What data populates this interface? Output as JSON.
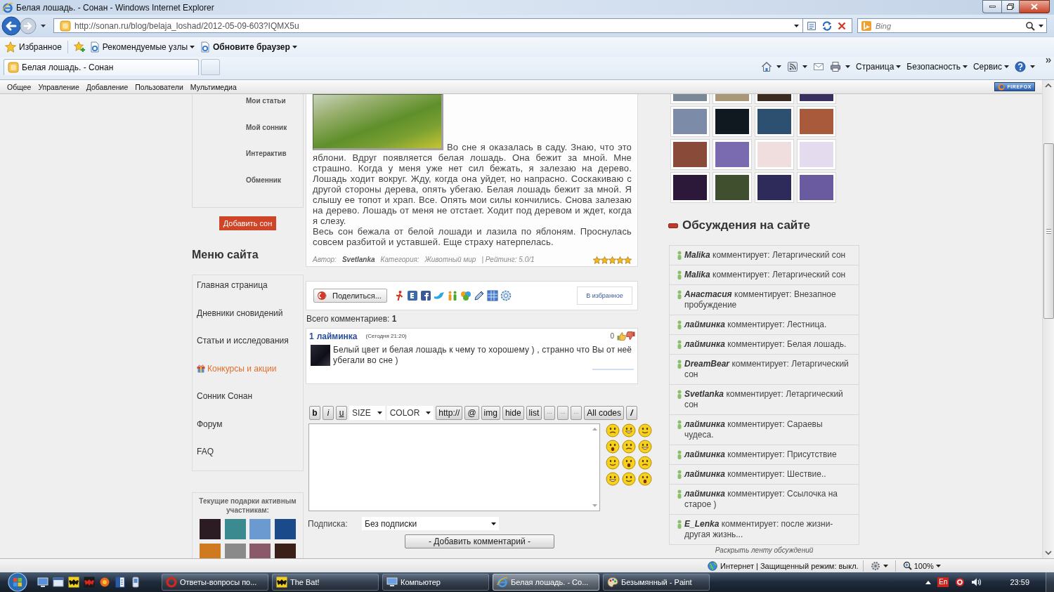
{
  "window": {
    "title": "Белая лошадь. - Сонан - Windows Internet Explorer"
  },
  "address_bar": {
    "url": "http://sonan.ru/blog/belaja_loshad/2012-05-09-603?IQMX5u",
    "search_placeholder": "Bing"
  },
  "favorites_bar": {
    "favorites": "Избранное",
    "links": [
      {
        "label": "Рекомендуемые узлы",
        "bold": false
      },
      {
        "label": "Обновите браузер",
        "bold": true
      }
    ]
  },
  "tabs": [
    {
      "label": "Белая лошадь. - Сонан",
      "selected": true
    }
  ],
  "command_bar": {
    "menus": [
      "Страница",
      "Безопасность",
      "Сервис"
    ]
  },
  "site_toolbar": {
    "items": [
      "Общее",
      "Управление",
      "Добавление",
      "Пользователи",
      "Мультимедиа"
    ],
    "badge": "FIREFOX"
  },
  "left_column": {
    "profile_links": [
      "Мои статьи",
      "Мой сонник",
      "Интерактив",
      "Обменник"
    ],
    "add_button": "Добавить сон",
    "menu_title": "Меню сайта",
    "menu_items": [
      {
        "label": "Главная страница",
        "kind": "link"
      },
      {
        "label": "Дневники сновидений",
        "kind": "link"
      },
      {
        "label": "Статьи и исследования",
        "kind": "link"
      },
      {
        "label": "Конкурсы и акции",
        "kind": "promo"
      },
      {
        "label": "Сонник Сонан",
        "kind": "link"
      },
      {
        "label": "Форум",
        "kind": "link"
      },
      {
        "label": "FAQ",
        "kind": "link"
      }
    ],
    "gifts_title": "Текущие подарки активным участникам:"
  },
  "article": {
    "paragraphs": [
      "Во сне я оказалась в саду. Знаю, что это яблони. Вдруг появляется белая лошадь. Она бежит за мной. Мне страшно. Когда у меня уже нет сил бежать, я залезаю на дерево. Лошадь ходит вокруг. Жду, когда она уйдет, но напрасно. Соскакиваю с другой стороны дерева, опять убегаю. Белая лошадь бежит за мной. Я слышу ее топот и храп. Все. Опять мои силы кончились. Снова залезаю на дерево. Лошадь от меня не отстает. Ходит под деревом и ждет, когда я слезу.",
      "Весь сон бежала от белой лошади и лазила по яблоням. Проснулась совсем разбитой и уставшей. Еще страху натерпелась."
    ],
    "author_label": "Автор:",
    "author": "Svetlanka",
    "category_label": "Категория:",
    "category": "Животный мир",
    "rating": "| Рейтинг: 5.0/1",
    "stars": 5
  },
  "share_bar": {
    "share_button": "Поделиться...",
    "favorite_button": "В избранное"
  },
  "comments": {
    "total": "Всего комментариев: **1**",
    "items": [
      {
        "number": "1",
        "author": "лайминка",
        "time": "(Сегодня 21:20)",
        "votes": "0",
        "text": "Белый цвет и белая лошадь к чему то хорошему ) , странно что Вы от неё убегали во сне )"
      }
    ]
  },
  "comment_form": {
    "toolbar": [
      {
        "label": "b",
        "kind": "bold"
      },
      {
        "label": "i",
        "kind": "italic"
      },
      {
        "label": "u",
        "kind": "underline"
      },
      {
        "label": "SIZE",
        "kind": "select"
      },
      {
        "label": "COLOR",
        "kind": "select"
      },
      {
        "label": "http://",
        "kind": "button"
      },
      {
        "label": "@",
        "kind": "button"
      },
      {
        "label": "img",
        "kind": "button"
      },
      {
        "label": "hide",
        "kind": "button"
      },
      {
        "label": "list",
        "kind": "button"
      },
      {
        "label": "···",
        "kind": "mini"
      },
      {
        "label": "···",
        "kind": "mini"
      },
      {
        "label": "···",
        "kind": "mini"
      },
      {
        "label": "All codes",
        "kind": "button"
      },
      {
        "label": "/",
        "kind": "bolditalic"
      }
    ],
    "subscription_label": "Подписка:",
    "subscription_value": "Без подписки",
    "submit": "- Добавить комментарий -"
  },
  "right_column": {
    "title": "Обсуждения на сайте",
    "discussions": [
      {
        "text": "**Malika** комментирует: Летаргический сон"
      },
      {
        "text": "**Malika** комментирует: Летаргический сон"
      },
      {
        "text": "**Анастасия** комментирует: Внезапное пробуждение"
      },
      {
        "text": "**лайминка** комментирует: Лестница."
      },
      {
        "text": "**лайминка** комментирует: Белая лошадь."
      },
      {
        "text": "**DreamBear** комментирует: Летаргический сон"
      },
      {
        "text": "**Svetlanka** комментирует: Летаргический сон"
      },
      {
        "text": "**лайминка** комментирует: Сараевы чудеса."
      },
      {
        "text": "**лайминка** комментирует: Присутствие"
      },
      {
        "text": "**лайминка** комментирует: Шествие.."
      },
      {
        "text": "**лайминка** комментирует: Ссылочка на старое )"
      },
      {
        "text": "**E_Lenka** комментирует: после жизни-другая жизнь..."
      }
    ],
    "more_link": "Раскрыть ленту обсуждений"
  },
  "status_bar": {
    "zone": "Интернет | Защищенный режим: выкл.",
    "zoom": "100%"
  },
  "taskbar": {
    "tasks": [
      {
        "label": "Ответы-вопросы по...",
        "kind": "ring",
        "selected": false
      },
      {
        "label": "The Bat!",
        "kind": "bat",
        "selected": false
      },
      {
        "label": "Компьютер",
        "kind": "computer",
        "selected": false
      },
      {
        "label": "Белая лошадь. - Со...",
        "kind": "browser",
        "selected": true
      },
      {
        "label": "Безымянный - Paint",
        "kind": "palette",
        "selected": false
      }
    ],
    "language": "En",
    "clock": "23:59"
  }
}
